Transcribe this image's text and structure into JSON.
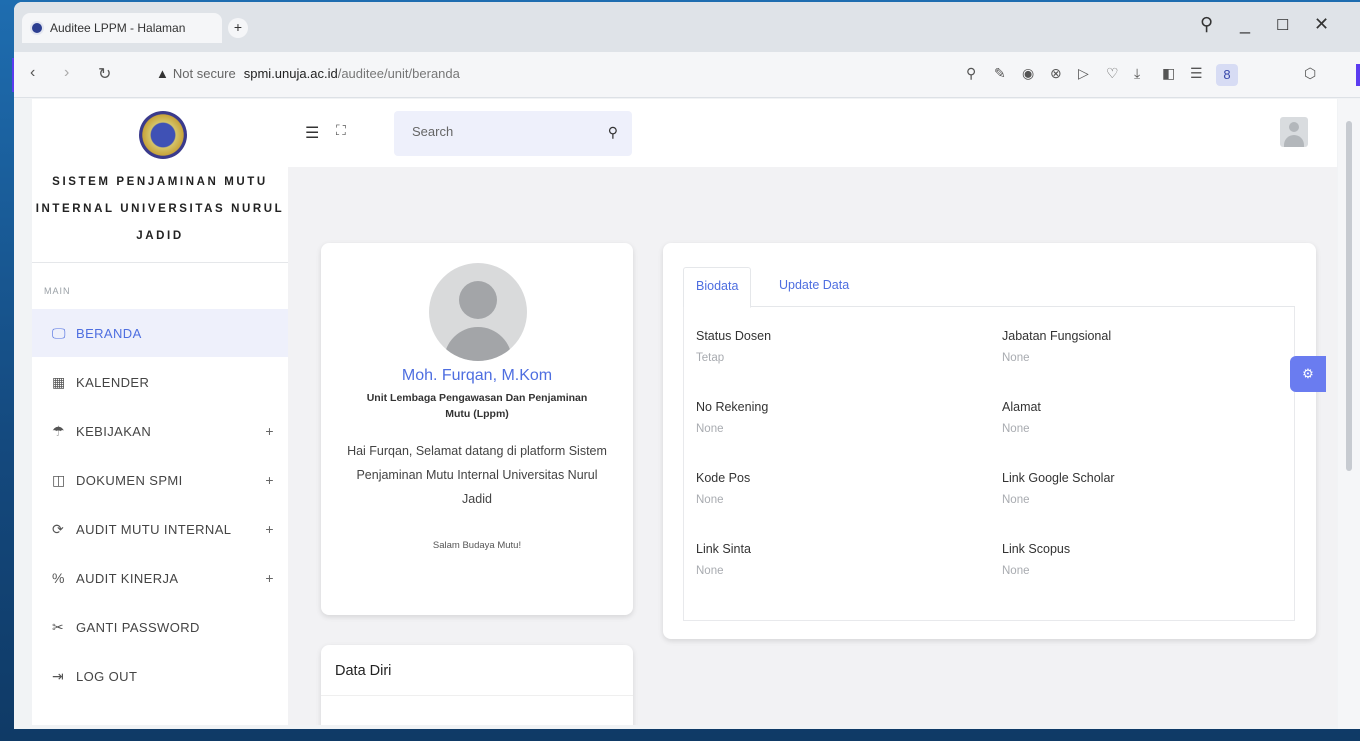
{
  "browser": {
    "tab_title": "Auditee LPPM - Halaman",
    "new_tab": "+",
    "url_warning": "Not secure",
    "url_host": "spmi.unuja.ac.id",
    "url_path": "/auditee/unit/beranda"
  },
  "sidebar": {
    "brand": "SISTEM PENJAMINAN MUTU INTERNAL UNIVERSITAS NURUL JADID",
    "section_label": "MAIN",
    "items": [
      {
        "label": "BERANDA",
        "icon": "monitor-icon",
        "glyph": "🖵",
        "active": true,
        "expand": ""
      },
      {
        "label": "KALENDER",
        "icon": "calendar-icon",
        "glyph": "▦",
        "active": false,
        "expand": ""
      },
      {
        "label": "KEBIJAKAN",
        "icon": "umbrella-icon",
        "glyph": "☂",
        "active": false,
        "expand": "+"
      },
      {
        "label": "DOKUMEN SPMI",
        "icon": "book-icon",
        "glyph": "◫",
        "active": false,
        "expand": "+"
      },
      {
        "label": "AUDIT MUTU INTERNAL",
        "icon": "refresh-icon",
        "glyph": "⟳",
        "active": false,
        "expand": "+"
      },
      {
        "label": "AUDIT KINERJA",
        "icon": "percent-icon",
        "glyph": "%",
        "active": false,
        "expand": "+"
      },
      {
        "label": "GANTI PASSWORD",
        "icon": "key-icon",
        "glyph": "✂",
        "active": false,
        "expand": ""
      },
      {
        "label": "LOG OUT",
        "icon": "logout-icon",
        "glyph": "⇥",
        "active": false,
        "expand": ""
      }
    ]
  },
  "header": {
    "search_placeholder": "Search"
  },
  "profile": {
    "name": "Moh. Furqan, M.Kom",
    "unit": "Unit Lembaga Pengawasan Dan Penjaminan Mutu (Lppm)",
    "greeting": "Hai Furqan, Selamat datang di platform Sistem Penjaminan Mutu Internal Universitas Nurul Jadid",
    "salam": "Salam Budaya Mutu!"
  },
  "data_diri": {
    "title": "Data Diri"
  },
  "biodata": {
    "tabs": [
      "Biodata",
      "Update Data"
    ],
    "fields": [
      {
        "label": "Status Dosen",
        "value": "Tetap"
      },
      {
        "label": "Jabatan Fungsional",
        "value": "None"
      },
      {
        "label": "No Rekening",
        "value": "None"
      },
      {
        "label": "Alamat",
        "value": "None"
      },
      {
        "label": "Kode Pos",
        "value": "None"
      },
      {
        "label": "Link Google Scholar",
        "value": "None"
      },
      {
        "label": "Link Sinta",
        "value": "None"
      },
      {
        "label": "Link Scopus",
        "value": "None"
      }
    ]
  },
  "colors": {
    "accent": "#4e6ee0",
    "active_bg": "#eef0fb"
  }
}
